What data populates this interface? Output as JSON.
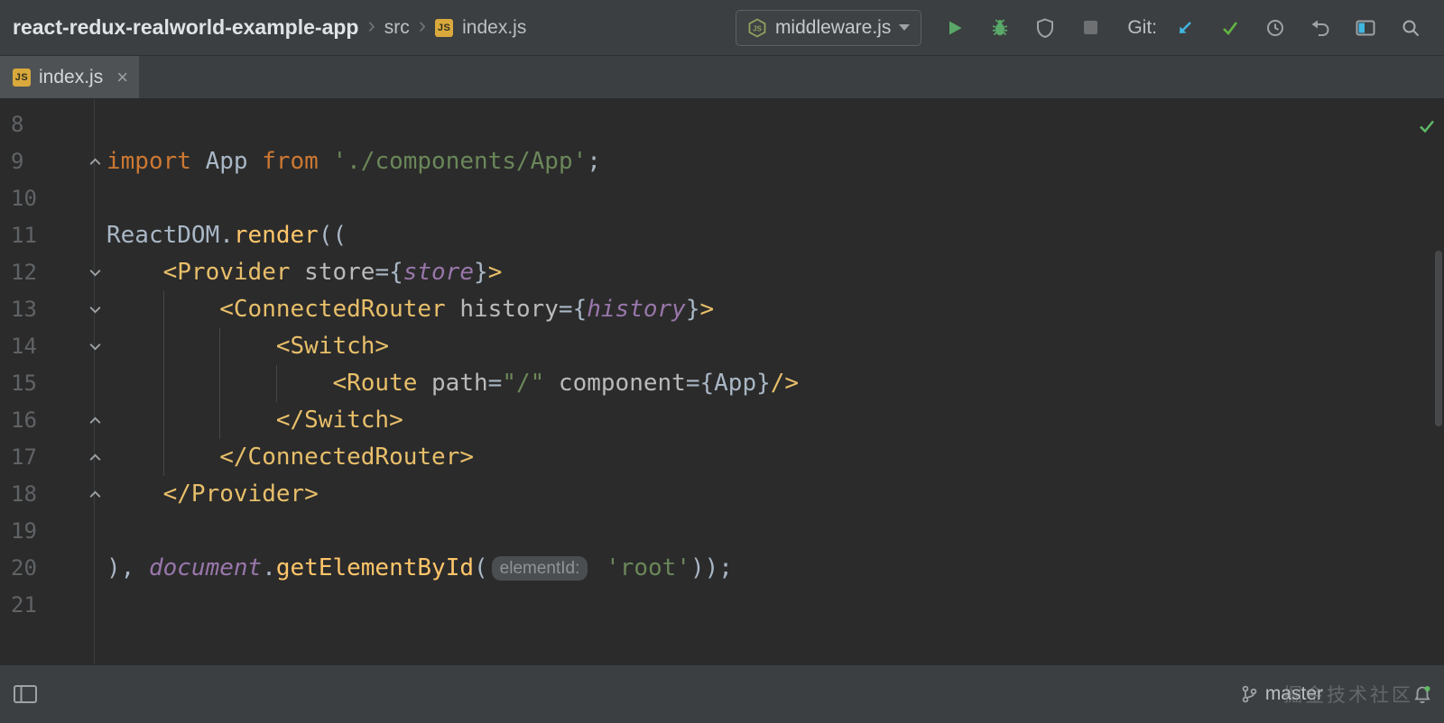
{
  "toolbar": {
    "project": "react-redux-realworld-example-app",
    "src": "src",
    "file": "index.js",
    "run_config": "middleware.js",
    "git_label": "Git:",
    "action_icons": [
      "run-icon",
      "debug-icon",
      "coverage-icon",
      "stop-icon",
      "update-project-icon",
      "commit-icon",
      "history-icon",
      "rollback-icon",
      "tool-windows-icon",
      "search-icon"
    ]
  },
  "tab": {
    "label": "index.js"
  },
  "icons": {
    "js_badge": "JS",
    "breadcrumb_separator": "›",
    "tab_close": "×"
  },
  "editor": {
    "lines": [
      {
        "n": "8",
        "fold": "",
        "segs": []
      },
      {
        "n": "9",
        "fold": "end",
        "segs": [
          {
            "t": "import ",
            "c": "kw"
          },
          {
            "t": "App ",
            "c": "text"
          },
          {
            "t": "from ",
            "c": "kw"
          },
          {
            "t": "'./components/App'",
            "c": "str"
          },
          {
            "t": ";",
            "c": "text"
          }
        ]
      },
      {
        "n": "10",
        "fold": "",
        "segs": []
      },
      {
        "n": "11",
        "fold": "",
        "segs": [
          {
            "t": "ReactDOM.",
            "c": "text"
          },
          {
            "t": "render",
            "c": "func"
          },
          {
            "t": "((",
            "c": "text"
          }
        ]
      },
      {
        "n": "12",
        "fold": "start",
        "segs": [
          {
            "t": "    ",
            "c": "text"
          },
          {
            "t": "<Provider",
            "c": "tag"
          },
          {
            "t": " store",
            "c": "attr"
          },
          {
            "t": "={",
            "c": "text"
          },
          {
            "t": "store",
            "c": "field"
          },
          {
            "t": "}",
            "c": "text"
          },
          {
            "t": ">",
            "c": "tag"
          }
        ]
      },
      {
        "n": "13",
        "fold": "start",
        "segs": [
          {
            "t": "        ",
            "c": "text"
          },
          {
            "t": "<ConnectedRouter",
            "c": "tag"
          },
          {
            "t": " history",
            "c": "attr"
          },
          {
            "t": "={",
            "c": "text"
          },
          {
            "t": "history",
            "c": "field"
          },
          {
            "t": "}",
            "c": "text"
          },
          {
            "t": ">",
            "c": "tag"
          }
        ]
      },
      {
        "n": "14",
        "fold": "start",
        "segs": [
          {
            "t": "            ",
            "c": "text"
          },
          {
            "t": "<Switch>",
            "c": "tag"
          }
        ]
      },
      {
        "n": "15",
        "fold": "",
        "segs": [
          {
            "t": "                ",
            "c": "text"
          },
          {
            "t": "<Route",
            "c": "tag"
          },
          {
            "t": " path",
            "c": "attr"
          },
          {
            "t": "=",
            "c": "text"
          },
          {
            "t": "\"/\"",
            "c": "str"
          },
          {
            "t": " component",
            "c": "attr"
          },
          {
            "t": "={",
            "c": "text"
          },
          {
            "t": "App",
            "c": "text"
          },
          {
            "t": "}",
            "c": "text"
          },
          {
            "t": "/>",
            "c": "tag"
          }
        ]
      },
      {
        "n": "16",
        "fold": "end",
        "segs": [
          {
            "t": "            ",
            "c": "text"
          },
          {
            "t": "</Switch>",
            "c": "tag"
          }
        ]
      },
      {
        "n": "17",
        "fold": "end",
        "segs": [
          {
            "t": "        ",
            "c": "text"
          },
          {
            "t": "</ConnectedRouter>",
            "c": "tag"
          }
        ]
      },
      {
        "n": "18",
        "fold": "end",
        "segs": [
          {
            "t": "    ",
            "c": "text"
          },
          {
            "t": "</Provider>",
            "c": "tag"
          }
        ]
      },
      {
        "n": "19",
        "fold": "",
        "segs": []
      },
      {
        "n": "20",
        "fold": "",
        "segs": [
          {
            "t": "), ",
            "c": "text"
          },
          {
            "t": "document",
            "c": "field"
          },
          {
            "t": ".",
            "c": "text"
          },
          {
            "t": "getElementById",
            "c": "func"
          },
          {
            "t": "(",
            "c": "text"
          },
          {
            "t": "elementId:",
            "c": "hint"
          },
          {
            "t": " ",
            "c": "text"
          },
          {
            "t": "'root'",
            "c": "str"
          },
          {
            "t": "));",
            "c": "text"
          }
        ]
      },
      {
        "n": "21",
        "fold": "",
        "segs": []
      }
    ]
  },
  "status": {
    "branch": "master",
    "watermark": "掘金技术社区",
    "icons": [
      "tool-window-toggle-icon",
      "git-branch-icon",
      "notifications-bell-icon"
    ]
  },
  "colors": {
    "editor_bg": "#2b2b2b",
    "chrome_bg": "#3c3f41",
    "tab_active_bg": "#4e5254",
    "keyword": "#cc7832",
    "string": "#6a8759",
    "jsx_tag": "#e8bf6a",
    "function_call": "#ffc66b",
    "global_field": "#9876aa",
    "attribute": "#bababa",
    "plain_text": "#a9b7c6",
    "line_number": "#606366",
    "hint_bg": "#4b4e50",
    "hint_text": "#8f9498",
    "run_green": "#59a869",
    "git_blue": "#40b6e0",
    "commit_green": "#62b543",
    "icon_grey": "#9da2a6"
  }
}
